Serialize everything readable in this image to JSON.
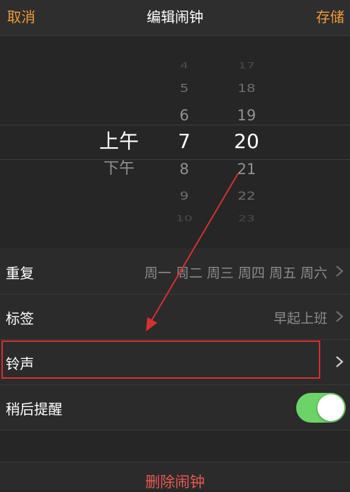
{
  "nav": {
    "cancel": "取消",
    "title": "编辑闹钟",
    "save": "存储"
  },
  "picker": {
    "period": {
      "items": [
        "上午",
        "下午"
      ],
      "selected": "上午"
    },
    "hours": {
      "items": [
        "4",
        "5",
        "6",
        "7",
        "8",
        "9",
        "10"
      ],
      "selected": "7"
    },
    "minutes": {
      "items": [
        "17",
        "18",
        "19",
        "20",
        "21",
        "22",
        "23"
      ],
      "selected": "20"
    }
  },
  "settings": {
    "repeat": {
      "label": "重复",
      "value": "周一 周二 周三 周四 周五 周六"
    },
    "tag": {
      "label": "标签",
      "value": "早起上班"
    },
    "ringtone": {
      "label": "铃声"
    },
    "snooze": {
      "label": "稍后提醒",
      "enabled": true
    }
  },
  "delete": {
    "label": "删除闹钟"
  },
  "colors": {
    "accent": "#f09a37",
    "background": "#262626",
    "row_background": "#2b2b2b",
    "toggle_on": "#6cd366",
    "delete": "#e8584f",
    "annotation": "#d6302f"
  },
  "icons": {
    "row_disclosure": "chevron-right-icon",
    "annotation_arrow": "arrow-icon"
  }
}
